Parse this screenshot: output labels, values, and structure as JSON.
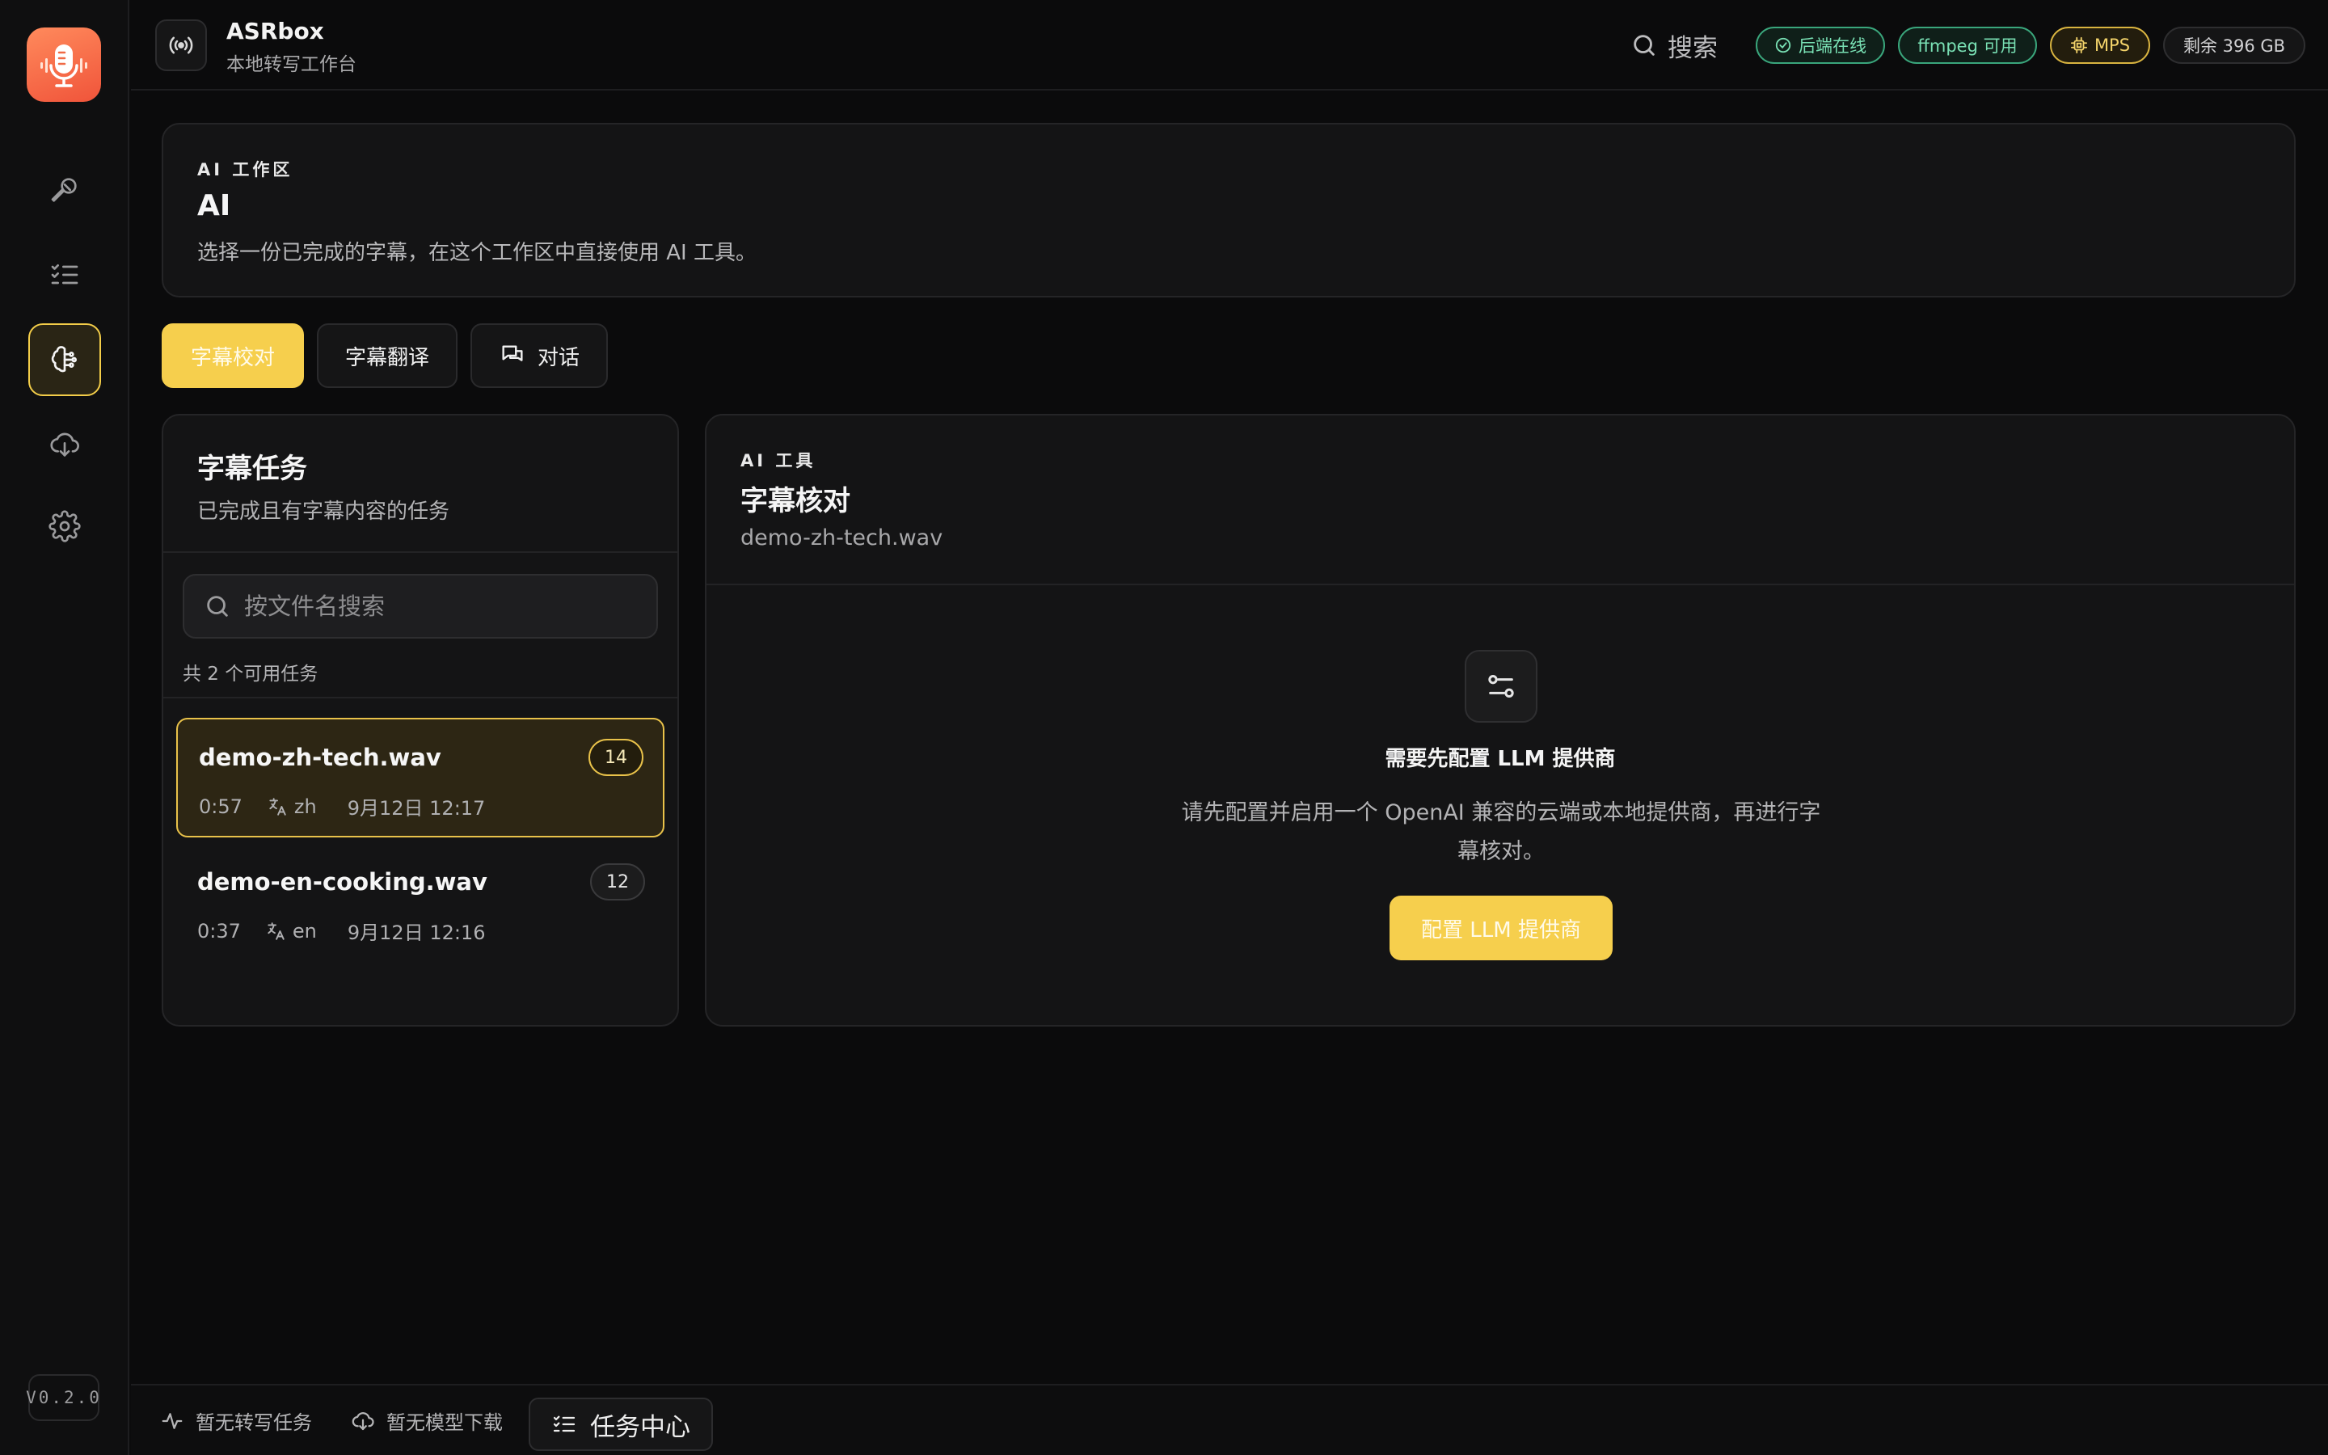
{
  "app": {
    "title": "ASRbox",
    "subtitle": "本地转写工作台",
    "version": "V0.2.0"
  },
  "sidebar": {
    "items": [
      {
        "icon": "microphone-icon",
        "active": false
      },
      {
        "icon": "task-list-icon",
        "active": false
      },
      {
        "icon": "ai-brain-icon",
        "active": true
      },
      {
        "icon": "cloud-download-icon",
        "active": false
      },
      {
        "icon": "gear-icon",
        "active": false
      }
    ]
  },
  "header": {
    "search_label": "搜索",
    "status": {
      "backend": "后端在线",
      "ffmpeg": "ffmpeg 可用",
      "device": "MPS",
      "disk": "剩余 396 GB"
    }
  },
  "hero": {
    "eyebrow": "AI 工作区",
    "title": "AI",
    "description": "选择一份已完成的字幕，在这个工作区中直接使用 AI 工具。"
  },
  "tabs": [
    {
      "label": "字幕校对",
      "active": true
    },
    {
      "label": "字幕翻译",
      "active": false
    },
    {
      "label": "对话",
      "active": false
    }
  ],
  "task_list": {
    "title": "字幕任务",
    "subtitle": "已完成且有字幕内容的任务",
    "search_placeholder": "按文件名搜索",
    "count_text": "共 2 个可用任务",
    "items": [
      {
        "name": "demo-zh-tech.wav",
        "count": "14",
        "duration": "0:57",
        "lang": "zh",
        "date": "9月12日 12:17",
        "active": true
      },
      {
        "name": "demo-en-cooking.wav",
        "count": "12",
        "duration": "0:37",
        "lang": "en",
        "date": "9月12日 12:16",
        "active": false
      }
    ]
  },
  "tool": {
    "eyebrow": "AI 工具",
    "title": "字幕核对",
    "file": "demo-zh-tech.wav",
    "empty_title": "需要先配置 LLM 提供商",
    "empty_desc": "请先配置并启用一个 OpenAI 兼容的云端或本地提供商，再进行字幕核对。",
    "button": "配置 LLM 提供商"
  },
  "bottombar": {
    "transcribe_status": "暂无转写任务",
    "download_status": "暂无模型下载",
    "task_center": "任务中心"
  },
  "colors": {
    "accent": "#f6cf4d",
    "background": "#0b0b0c",
    "panel": "#141415",
    "success": "#79e0b4"
  }
}
